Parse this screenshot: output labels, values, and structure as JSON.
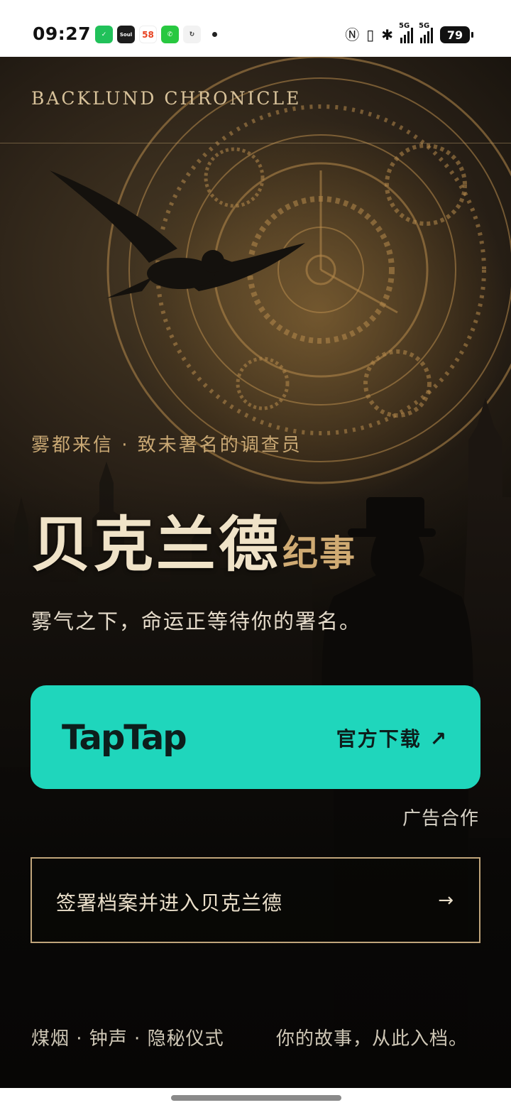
{
  "status_bar": {
    "time": "09:27",
    "apps": [
      {
        "icon": "wechat-icon",
        "text": "✓"
      },
      {
        "icon": "soul-icon",
        "text": "Soul"
      },
      {
        "icon": "58-icon",
        "text": "58"
      },
      {
        "icon": "phone-icon",
        "text": "✆"
      },
      {
        "icon": "sync-icon",
        "text": "↻"
      }
    ],
    "network_1": "5G",
    "network_2": "5G",
    "battery": "79"
  },
  "hero": {
    "brand": "BACKLUND CHRONICLE",
    "kicker": "雾都来信 · 致未署名的调查员",
    "title_main": "贝克兰德",
    "title_sub": "纪事",
    "tagline": "雾气之下，命运正等待你的署名。"
  },
  "taptap": {
    "logo": "TapTap",
    "cta": "官方下载 ↗",
    "accent": "#1fd6bc"
  },
  "ad_label": "广告合作",
  "enter": {
    "label": "签署档案并进入贝克兰德",
    "arrow": "→"
  },
  "footer": {
    "left": "煤烟 · 钟声 · 隐秘仪式",
    "right": "你的故事，从此入档。"
  }
}
